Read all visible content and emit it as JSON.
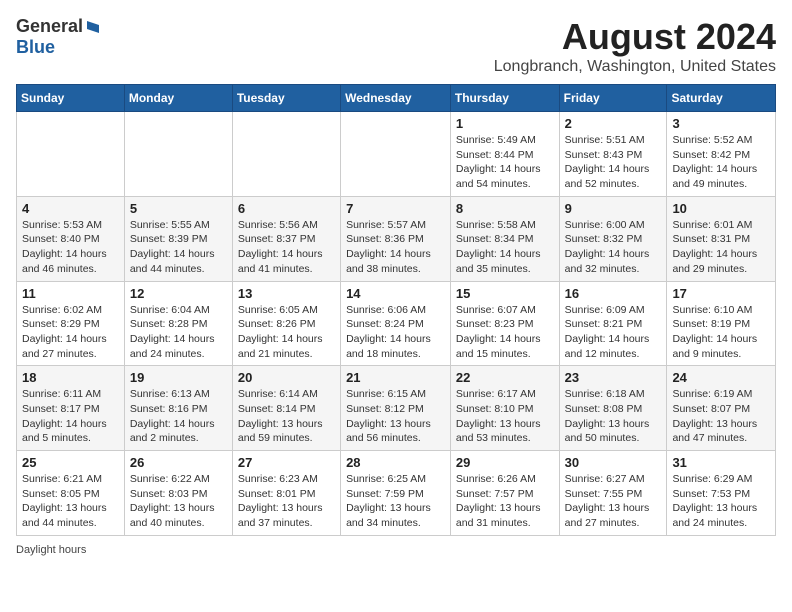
{
  "logo": {
    "general": "General",
    "blue": "Blue"
  },
  "title": {
    "month": "August 2024",
    "location": "Longbranch, Washington, United States"
  },
  "days_header": [
    "Sunday",
    "Monday",
    "Tuesday",
    "Wednesday",
    "Thursday",
    "Friday",
    "Saturday"
  ],
  "footer": {
    "daylight_hours": "Daylight hours"
  },
  "weeks": [
    [
      {
        "day": "",
        "info": ""
      },
      {
        "day": "",
        "info": ""
      },
      {
        "day": "",
        "info": ""
      },
      {
        "day": "",
        "info": ""
      },
      {
        "day": "1",
        "info": "Sunrise: 5:49 AM\nSunset: 8:44 PM\nDaylight: 14 hours\nand 54 minutes."
      },
      {
        "day": "2",
        "info": "Sunrise: 5:51 AM\nSunset: 8:43 PM\nDaylight: 14 hours\nand 52 minutes."
      },
      {
        "day": "3",
        "info": "Sunrise: 5:52 AM\nSunset: 8:42 PM\nDaylight: 14 hours\nand 49 minutes."
      }
    ],
    [
      {
        "day": "4",
        "info": "Sunrise: 5:53 AM\nSunset: 8:40 PM\nDaylight: 14 hours\nand 46 minutes."
      },
      {
        "day": "5",
        "info": "Sunrise: 5:55 AM\nSunset: 8:39 PM\nDaylight: 14 hours\nand 44 minutes."
      },
      {
        "day": "6",
        "info": "Sunrise: 5:56 AM\nSunset: 8:37 PM\nDaylight: 14 hours\nand 41 minutes."
      },
      {
        "day": "7",
        "info": "Sunrise: 5:57 AM\nSunset: 8:36 PM\nDaylight: 14 hours\nand 38 minutes."
      },
      {
        "day": "8",
        "info": "Sunrise: 5:58 AM\nSunset: 8:34 PM\nDaylight: 14 hours\nand 35 minutes."
      },
      {
        "day": "9",
        "info": "Sunrise: 6:00 AM\nSunset: 8:32 PM\nDaylight: 14 hours\nand 32 minutes."
      },
      {
        "day": "10",
        "info": "Sunrise: 6:01 AM\nSunset: 8:31 PM\nDaylight: 14 hours\nand 29 minutes."
      }
    ],
    [
      {
        "day": "11",
        "info": "Sunrise: 6:02 AM\nSunset: 8:29 PM\nDaylight: 14 hours\nand 27 minutes."
      },
      {
        "day": "12",
        "info": "Sunrise: 6:04 AM\nSunset: 8:28 PM\nDaylight: 14 hours\nand 24 minutes."
      },
      {
        "day": "13",
        "info": "Sunrise: 6:05 AM\nSunset: 8:26 PM\nDaylight: 14 hours\nand 21 minutes."
      },
      {
        "day": "14",
        "info": "Sunrise: 6:06 AM\nSunset: 8:24 PM\nDaylight: 14 hours\nand 18 minutes."
      },
      {
        "day": "15",
        "info": "Sunrise: 6:07 AM\nSunset: 8:23 PM\nDaylight: 14 hours\nand 15 minutes."
      },
      {
        "day": "16",
        "info": "Sunrise: 6:09 AM\nSunset: 8:21 PM\nDaylight: 14 hours\nand 12 minutes."
      },
      {
        "day": "17",
        "info": "Sunrise: 6:10 AM\nSunset: 8:19 PM\nDaylight: 14 hours\nand 9 minutes."
      }
    ],
    [
      {
        "day": "18",
        "info": "Sunrise: 6:11 AM\nSunset: 8:17 PM\nDaylight: 14 hours\nand 5 minutes."
      },
      {
        "day": "19",
        "info": "Sunrise: 6:13 AM\nSunset: 8:16 PM\nDaylight: 14 hours\nand 2 minutes."
      },
      {
        "day": "20",
        "info": "Sunrise: 6:14 AM\nSunset: 8:14 PM\nDaylight: 13 hours\nand 59 minutes."
      },
      {
        "day": "21",
        "info": "Sunrise: 6:15 AM\nSunset: 8:12 PM\nDaylight: 13 hours\nand 56 minutes."
      },
      {
        "day": "22",
        "info": "Sunrise: 6:17 AM\nSunset: 8:10 PM\nDaylight: 13 hours\nand 53 minutes."
      },
      {
        "day": "23",
        "info": "Sunrise: 6:18 AM\nSunset: 8:08 PM\nDaylight: 13 hours\nand 50 minutes."
      },
      {
        "day": "24",
        "info": "Sunrise: 6:19 AM\nSunset: 8:07 PM\nDaylight: 13 hours\nand 47 minutes."
      }
    ],
    [
      {
        "day": "25",
        "info": "Sunrise: 6:21 AM\nSunset: 8:05 PM\nDaylight: 13 hours\nand 44 minutes."
      },
      {
        "day": "26",
        "info": "Sunrise: 6:22 AM\nSunset: 8:03 PM\nDaylight: 13 hours\nand 40 minutes."
      },
      {
        "day": "27",
        "info": "Sunrise: 6:23 AM\nSunset: 8:01 PM\nDaylight: 13 hours\nand 37 minutes."
      },
      {
        "day": "28",
        "info": "Sunrise: 6:25 AM\nSunset: 7:59 PM\nDaylight: 13 hours\nand 34 minutes."
      },
      {
        "day": "29",
        "info": "Sunrise: 6:26 AM\nSunset: 7:57 PM\nDaylight: 13 hours\nand 31 minutes."
      },
      {
        "day": "30",
        "info": "Sunrise: 6:27 AM\nSunset: 7:55 PM\nDaylight: 13 hours\nand 27 minutes."
      },
      {
        "day": "31",
        "info": "Sunrise: 6:29 AM\nSunset: 7:53 PM\nDaylight: 13 hours\nand 24 minutes."
      }
    ]
  ]
}
